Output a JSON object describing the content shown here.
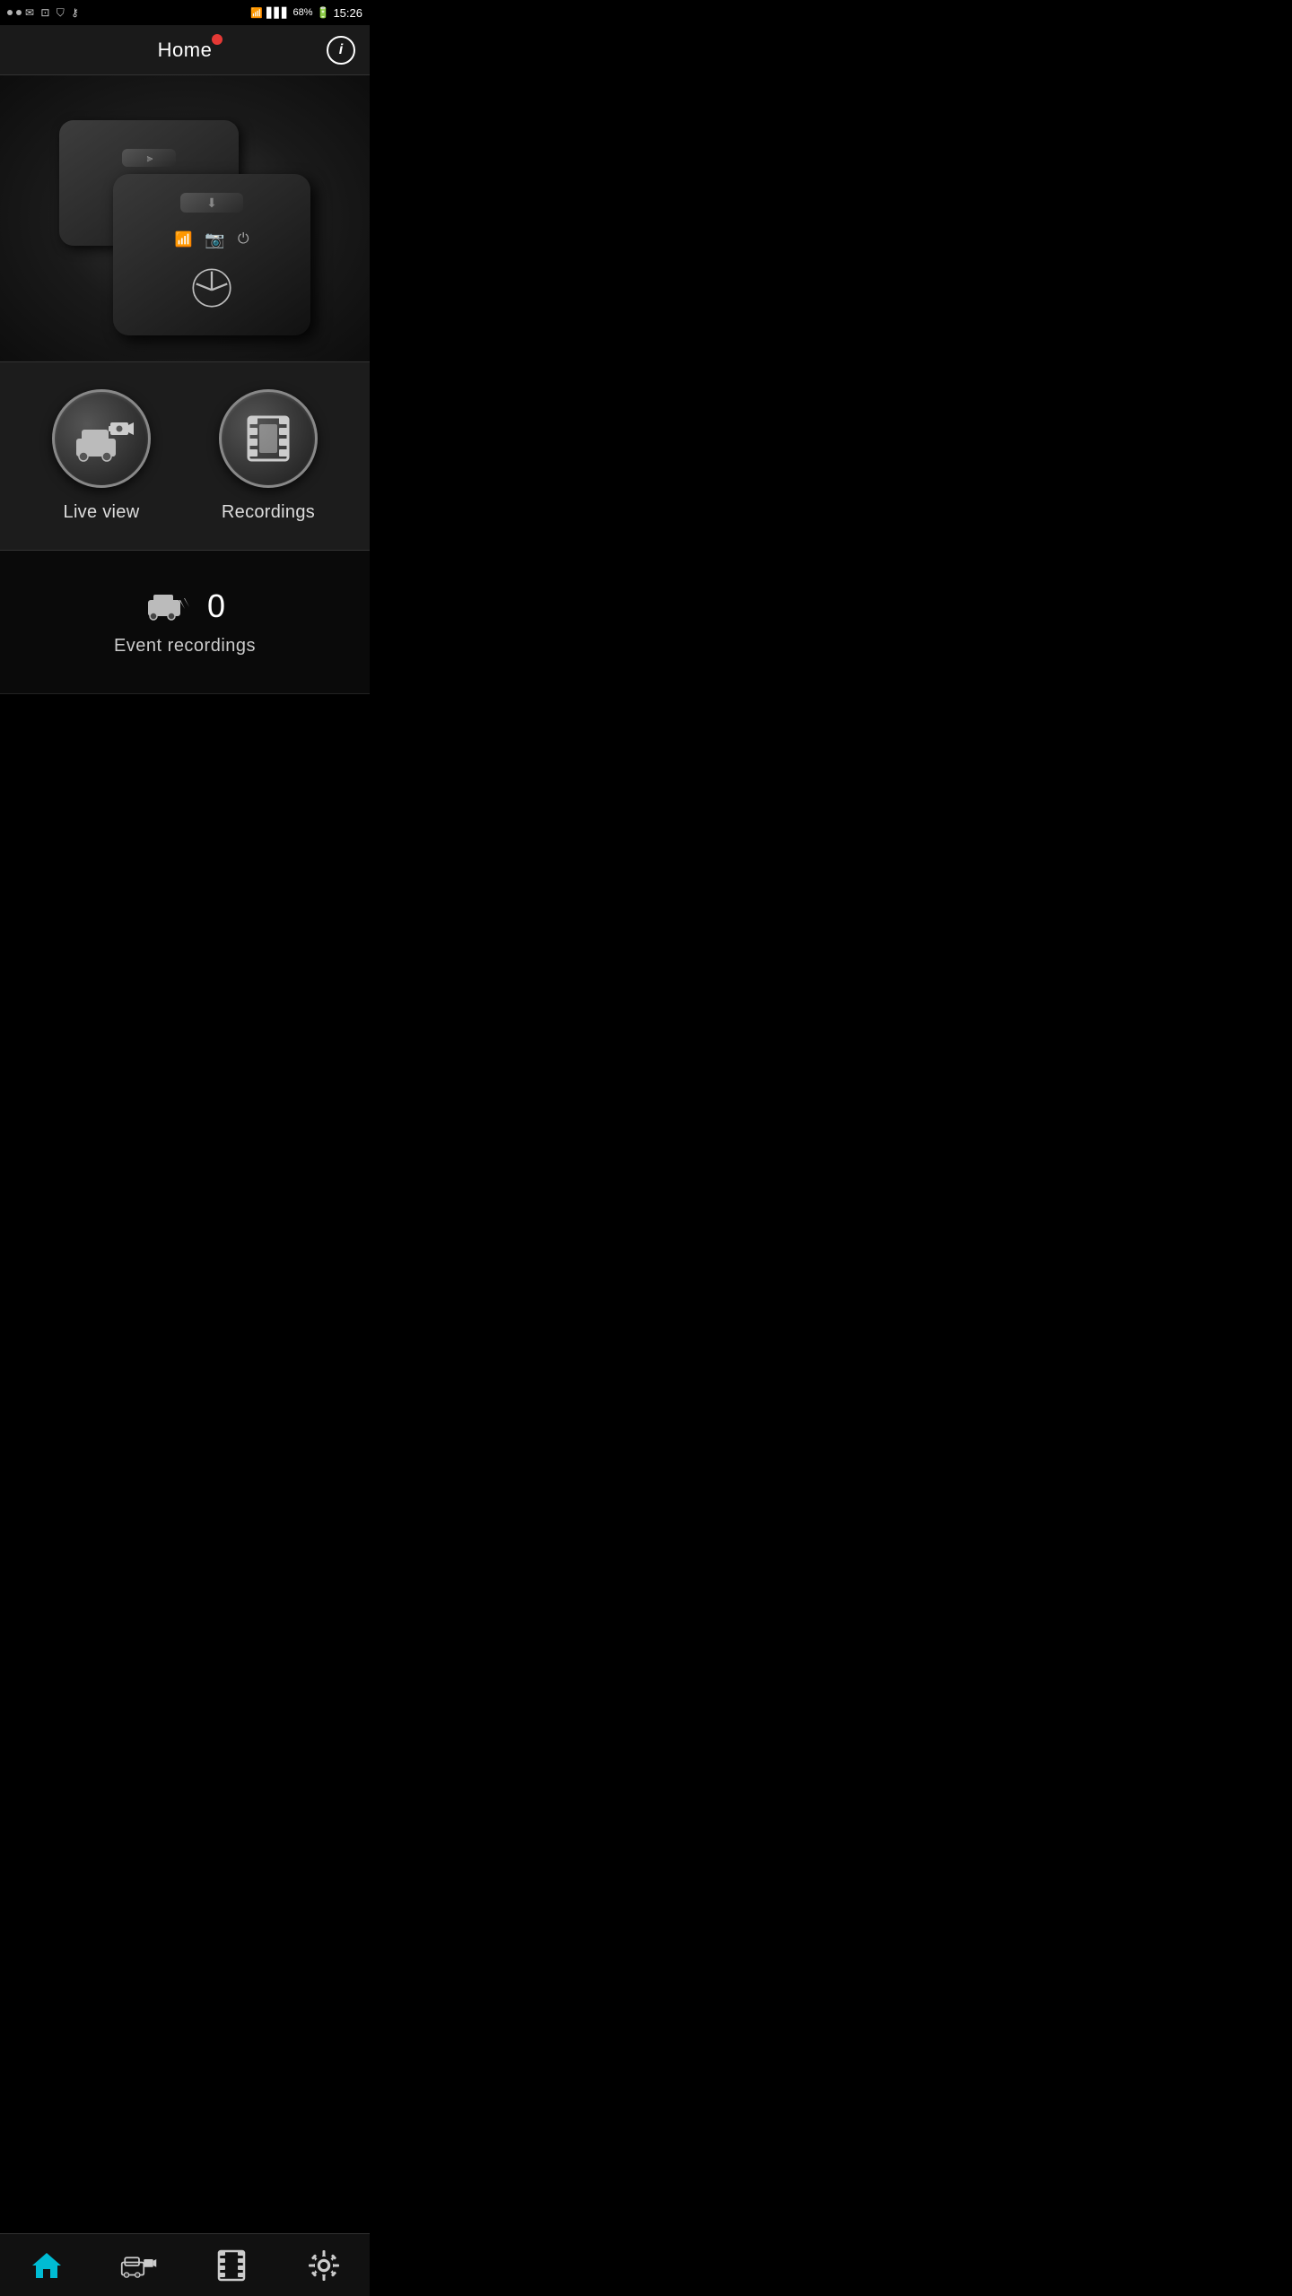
{
  "statusBar": {
    "battery": "68%",
    "time": "15:26"
  },
  "topNav": {
    "title": "Home",
    "infoLabel": "i"
  },
  "actions": [
    {
      "id": "live-view",
      "label": "Live view"
    },
    {
      "id": "recordings",
      "label": "Recordings"
    }
  ],
  "eventSection": {
    "count": "0",
    "label": "Event recordings"
  },
  "bottomNav": {
    "items": [
      {
        "id": "home",
        "label": "Home",
        "active": true
      },
      {
        "id": "live",
        "label": "Live",
        "active": false
      },
      {
        "id": "recordings",
        "label": "Recordings",
        "active": false
      },
      {
        "id": "settings",
        "label": "Settings",
        "active": false
      }
    ]
  }
}
